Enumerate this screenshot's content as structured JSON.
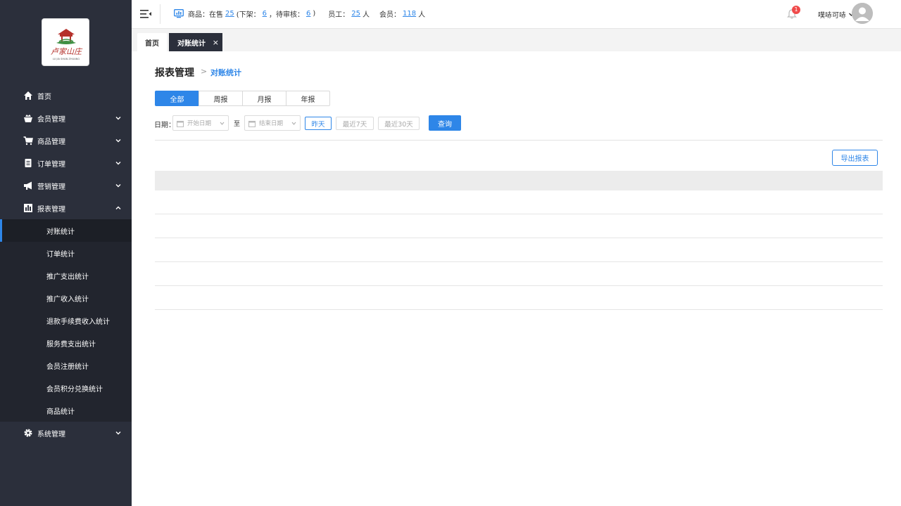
{
  "sidebar": {
    "logo": {
      "line1": "卢家山庄",
      "line2": "LU JIA SHAN ZHUANG"
    },
    "menu": [
      {
        "label": "首页",
        "icon": "home-icon",
        "expandable": false
      },
      {
        "label": "会员管理",
        "icon": "crown-basket-icon",
        "expandable": true
      },
      {
        "label": "商品管理",
        "icon": "cart-icon",
        "expandable": true
      },
      {
        "label": "订单管理",
        "icon": "list-doc-icon",
        "expandable": true
      },
      {
        "label": "营销管理",
        "icon": "megaphone-icon",
        "expandable": true
      },
      {
        "label": "报表管理",
        "icon": "bar-chart-icon",
        "expandable": true,
        "expanded": true
      },
      {
        "label": "系统管理",
        "icon": "gear-icon",
        "expandable": true
      }
    ],
    "report_submenu": [
      {
        "label": "对账统计",
        "active": true
      },
      {
        "label": "订单统计"
      },
      {
        "label": "推广支出统计"
      },
      {
        "label": "推广收入统计"
      },
      {
        "label": "退款手续费收入统计"
      },
      {
        "label": "服务费支出统计"
      },
      {
        "label": "会员注册统计"
      },
      {
        "label": "会员积分兑换统计"
      },
      {
        "label": "商品统计"
      }
    ]
  },
  "header": {
    "goods_label": "商品：在售",
    "goods_on_sale": "25",
    "off_shelf_label": "(下架：",
    "off_shelf": "6",
    "pending_label": "，待审核：",
    "pending": "6",
    "close_paren": ")",
    "staff_label": "员工：",
    "staff_count": "25",
    "staff_unit": "人",
    "member_label": "会员：",
    "member_count": "118",
    "member_unit": "人",
    "notification_count": "1",
    "username": "噗哧可哧"
  },
  "tabs": [
    {
      "label": "首页"
    },
    {
      "label": "对账统计",
      "active": true,
      "close": "×"
    }
  ],
  "main": {
    "title": "报表管理",
    "crumb_sep": ">",
    "crumb": "对账统计",
    "periods": [
      {
        "label": "全部",
        "active": true
      },
      {
        "label": "周报"
      },
      {
        "label": "月报"
      },
      {
        "label": "年报"
      }
    ],
    "date_label": "日期：",
    "start_placeholder": "开始日期",
    "to_label": "至",
    "end_placeholder": "结束日期",
    "quick": [
      {
        "label": "昨天",
        "active": true
      },
      {
        "label": "最近7天"
      },
      {
        "label": "最近30天"
      }
    ],
    "query_button": "查询",
    "export_button": "导出报表",
    "table_rows": 5
  },
  "colors": {
    "sidebar_bg": "#2b2f3b",
    "accent": "#2e86e8",
    "badge": "#f04a4a"
  }
}
